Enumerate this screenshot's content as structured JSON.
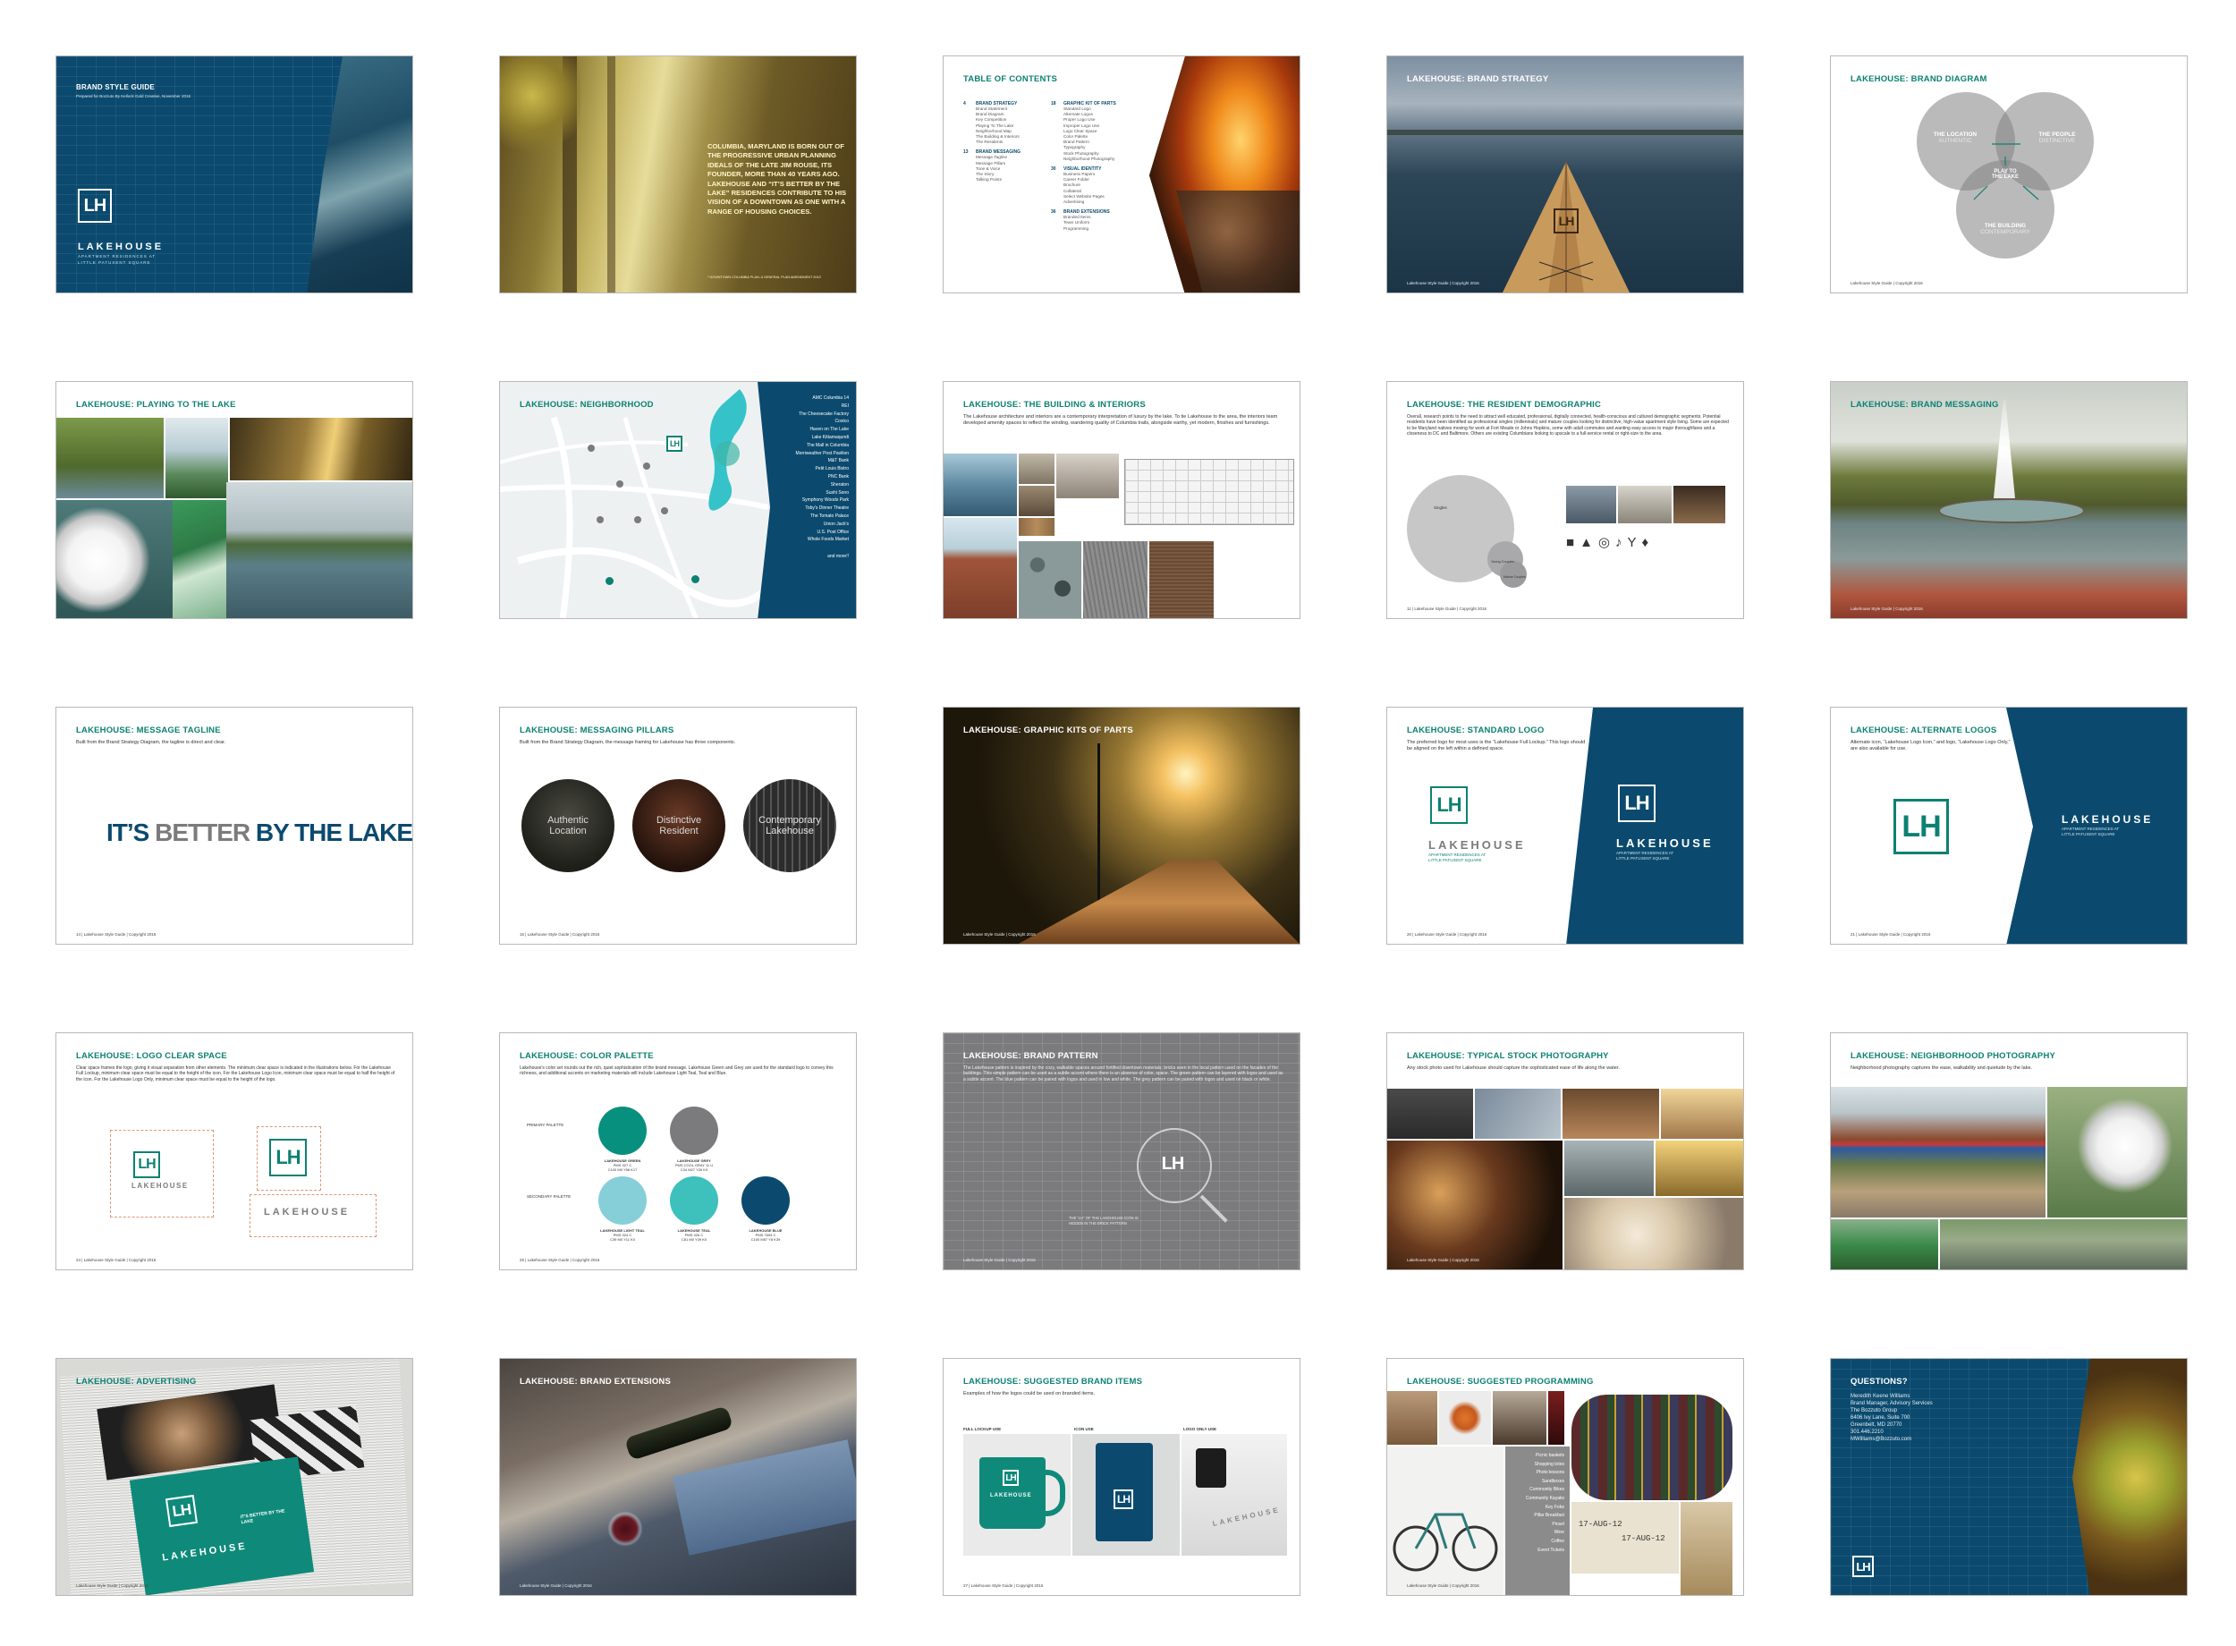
{
  "brand": {
    "name": "LAKEHOUSE",
    "monogram": "LH",
    "subline1": "APARTMENT RESIDENCES AT",
    "subline2": "LITTLE PATUXENT SQUARE"
  },
  "footer": {
    "p9": "9 | Lakehouse Style Guide | Copyright 2016",
    "p11": "11 | Lakehouse Style Guide | Copyright 2016",
    "p14": "14 | Lakehouse Style Guide | Copyright 2016",
    "p15": "15 | Lakehouse Style Guide | Copyright 2016",
    "p16": "16 | Lakehouse Style Guide | Copyright 2016",
    "p20": "20 | Lakehouse Style Guide | Copyright 2016",
    "p21": "21 | Lakehouse Style Guide | Copyright 2016",
    "p24": "24 | Lakehouse Style Guide | Copyright 2016",
    "p25": "25 | Lakehouse Style Guide | Copyright 2016",
    "p26": "26 | Lakehouse Style Guide | Copyright 2016",
    "p27": "27 | Lakehouse Style Guide | Copyright 2016",
    "generic": "Lakehouse Style Guide | Copyright 2016"
  },
  "s1": {
    "title": "BRAND STYLE GUIDE",
    "subtitle": "Prepared for Bozzuto By Kellock Gold Creative, November 2016"
  },
  "s2": {
    "quote": "COLUMBIA, MARYLAND IS BORN OUT OF THE PROGRESSIVE URBAN PLANNING IDEALS OF THE LATE JIM ROUSE, ITS FOUNDER, MORE THAN 40 YEARS AGO. LAKEHOUSE AND “IT’S BETTER BY THE LAKE” RESIDENCES CONTRIBUTE TO HIS VISION OF A DOWNTOWN AS ONE WITH A RANGE OF HOUSING CHOICES.",
    "footnote": "* DOWNTOWN COLUMBIA PLAN: A GENERAL PLAN AMENDMENT 2010"
  },
  "s3": {
    "title": "TABLE OF CONTENTS",
    "col1": [
      {
        "num": "4",
        "head": "BRAND STRATEGY",
        "items": [
          "Brand Statement",
          "Brand Diagram",
          "Key Competition",
          "Playing To The Lake",
          "Neighborhood Map",
          "The Building & Interiors",
          "The Residents"
        ]
      },
      {
        "num": "13",
        "head": "BRAND MESSAGING",
        "items": [
          "Message Tagline",
          "Message Pillars",
          "Tone & Voice",
          "The Story",
          "Talking Points"
        ]
      }
    ],
    "col2": [
      {
        "num": "18",
        "head": "GRAPHIC KIT OF PARTS",
        "items": [
          "Standard Logo",
          "Alternate Logos",
          "Proper Logo Use",
          "Improper Logo Use",
          "Logo Clear Space",
          "Color Palette",
          "Brand Pattern",
          "Typography",
          "Stock Photography",
          "Neighborhood Photography"
        ]
      },
      {
        "num": "30",
        "head": "VISUAL IDENTITY",
        "items": [
          "Business Papers",
          "Career Folder",
          "Brochure",
          "Collateral",
          "Select Website Pages",
          "Advertising"
        ]
      },
      {
        "num": "36",
        "head": "BRAND EXTENSIONS",
        "items": [
          "Branded Items",
          "Team Uniform",
          "Programming"
        ]
      }
    ]
  },
  "s4": {
    "title": "LAKEHOUSE: BRAND STRATEGY"
  },
  "s5": {
    "title": "LAKEHOUSE: BRAND DIAGRAM",
    "c1a": "THE LOCATION",
    "c1b": "AUTHENTIC",
    "c2a": "THE PEOPLE",
    "c2b": "DISTINCTIVE",
    "c3a": "THE BUILDING",
    "c3b": "CONTEMPORARY",
    "center1": "PLAY TO",
    "center2": "THE LAKE"
  },
  "s6": {
    "title": "LAKEHOUSE: PLAYING TO THE LAKE"
  },
  "s7": {
    "title": "LAKEHOUSE: NEIGHBORHOOD",
    "list": [
      "AMC Columbia 14",
      "REI",
      "The Cheesecake Factory",
      "Costco",
      "Haven on The Lake",
      "Lake Kittamaqundi",
      "The Mall in Columbia",
      "Merriweather Post Pavilion",
      "M&T Bank",
      "Petit Louis Bistro",
      "PNC Bank",
      "Sheraton",
      "Sushi Sono",
      "Symphony Woods Park",
      "Toby's Dinner Theatre",
      "The Tomato Palace",
      "Union Jack's",
      "U.S. Post Office",
      "Whole Foods Market"
    ],
    "more": "and more!!"
  },
  "s8": {
    "title": "LAKEHOUSE: THE BUILDING & INTERIORS",
    "text": "The Lakehouse architecture and interiors are a contemporary interpretation of luxury by the lake. To tie Lakehouse to the area, the interiors team developed amenity spaces to reflect the winding, wandering quality of Columbia trails, alongside earthy, yet modern, finishes and furnishings."
  },
  "s9": {
    "title": "LAKEHOUSE: THE RESIDENT DEMOGRAPHIC",
    "text": "Overall, research points to the need to attract well educated, professional, digitally connected, health-conscious and cultured demographic segments. Potential residents have been identified as professional singles (millennials) and mature couples looking for distinctive, high-value apartment style living. Some are expected to be Maryland natives moving for work at Fort Meade or Johns Hopkins, some with adult commutes and wanting easy access to major thoroughfares and a closeness to DC and Baltimore. Others are existing Columbians looking to upscale to a full-service rental or right-size to the area.",
    "singles": "Singles",
    "couples": "Young Couples",
    "mature": "Mature Couples"
  },
  "s10": {
    "title": "LAKEHOUSE: BRAND MESSAGING"
  },
  "s11": {
    "title": "LAKEHOUSE: MESSAGE TAGLINE",
    "text": "Built from the Brand Strategy Diagram, the tagline is direct and clear.",
    "t1": "IT’S ",
    "t2": "BETTER",
    "t3": " BY THE LAKE"
  },
  "s12": {
    "title": "LAKEHOUSE: MESSAGING PILLARS",
    "text": "Built from the Brand Strategy Diagram, the message framing for Lakehouse has three components.",
    "p1a": "Authentic",
    "p1b": "Location",
    "p2a": "Distinctive",
    "p2b": "Resident",
    "p3a": "Contemporary",
    "p3b": "Lakehouse"
  },
  "s13": {
    "title": "LAKEHOUSE: GRAPHIC KITS OF PARTS"
  },
  "s14": {
    "title": "LAKEHOUSE: STANDARD LOGO",
    "text": "The preferred logo for most uses is the “Lakehouse Full Lockup.” This logo should be aligned on the left within a defined space."
  },
  "s15": {
    "title": "LAKEHOUSE: ALTERNATE LOGOS",
    "text": "Alternate icon, “Lakehouse Logo Icon,” and logo, “Lakehouse Logo Only,” are also available for use."
  },
  "s16": {
    "title": "LAKEHOUSE: LOGO CLEAR SPACE",
    "text": "Clear space frames the logo, giving it visual separation from other elements. The minimum clear space is indicated in the illustrations below. For the Lakehouse Full Lockup, minimum clear space must be equal to the height of the icon. For the Lakehouse Logo Icon, minimum clear space must be equal to half the height of the icon. For the Lakehouse Logo Only, minimum clear space must be equal to the height of the logo."
  },
  "s17": {
    "title": "LAKEHOUSE: COLOR PALETTE",
    "text": "Lakehouse's color set rounds out the rich, quiet sophistication of the brand message. Lakehouse Green and Grey are used for the standard logo to convey this richness, and additional accents on marketing materials will include Lakehouse Light Teal, Teal and Blue.",
    "primary": "PRIMARY PALETTE",
    "secondary": "SECONDARY PALETTE",
    "swatches": [
      {
        "name": "LAKEHOUSE GREEN",
        "spec1": "PMS 327 C",
        "spec2": "C100 M0 Y56 K17",
        "color": "#08907e"
      },
      {
        "name": "LAKEHOUSE GREY",
        "spec1": "PMS COOL GRAY 11 U",
        "spec2": "C34 M27 Y26 K0",
        "color": "#7b7b7d"
      },
      {
        "name": "LAKEHOUSE LIGHT TEAL",
        "spec1": "PMS 324 C",
        "spec2": "C39 M0 Y11 K0",
        "color": "#86cfd9"
      },
      {
        "name": "LAKEHOUSE TEAL",
        "spec1": "PMS 326 C",
        "spec2": "C81 M0 Y39 K0",
        "color": "#3ec0bd"
      },
      {
        "name": "LAKEHOUSE BLUE",
        "spec1": "PMS 7694 C",
        "spec2": "C100 M57 Y8 K39",
        "color": "#0b4a6e"
      }
    ]
  },
  "s18": {
    "title": "LAKEHOUSE: BRAND PATTERN",
    "text": "The Lakehouse pattern is inspired by the cozy, walkable spaces around fortified downtown materials; bricks seen in the local pattern used on the facades of the buildings. This simple pattern can be used as a subtle accent where there is an absence of color, space. The green pattern can be layered with logos and used as a subtle accent. The blue pattern can be paired with logos and used in low and white. The grey pattern can be paired with logos and used on black or white.",
    "caption": "THE “LH” OF THE LAKEHOUSE ICON IS HIDDEN IN THE BRICK PATTERN"
  },
  "s19": {
    "title": "LAKEHOUSE: TYPICAL STOCK PHOTOGRAPHY",
    "text": "Any stock photo used for Lakehouse should capture the sophisticated ease of life along the water."
  },
  "s20": {
    "title": "LAKEHOUSE: NEIGHBORHOOD PHOTOGRAPHY",
    "text": "Neighborhood photography captures the ease, walkability and quietude by the lake."
  },
  "s21": {
    "title": "LAKEHOUSE: ADVERTISING",
    "adtext": "IT'S BETTER BY THE LAKE"
  },
  "s22": {
    "title": "LAKEHOUSE: BRAND EXTENSIONS"
  },
  "s23": {
    "title": "LAKEHOUSE: SUGGESTED BRAND ITEMS",
    "text": "Examples of how the logos could be used on branded items.",
    "l1": "FULL LOCKUP USE",
    "l2": "ICON USE",
    "l3": "LOGO ONLY USE"
  },
  "s24": {
    "title": "LAKEHOUSE: SUGGESTED PROGRAMMING",
    "list": [
      "Picnic baskets",
      "Shopping totes",
      "Photo lessons",
      "Sandboxes",
      "Community Bikes",
      "Community Kayaks",
      "Key Fobs",
      "Pillar Breakfast",
      "Pinsel",
      "Wine",
      "Coffee",
      "Event Tickets"
    ],
    "tag1": "17-AUG-12",
    "tag2": "17-AUG-12"
  },
  "s25": {
    "title": "QUESTIONS?",
    "lines": [
      "Meredith Keene Williams",
      "Brand Manager, Advisory Services",
      "The Bozzuto Group",
      "6406 Ivy Lane, Suite 700",
      "Greenbelt, MD 20770",
      "301.446.2210",
      "MWilliams@Bozzuto.com"
    ]
  }
}
